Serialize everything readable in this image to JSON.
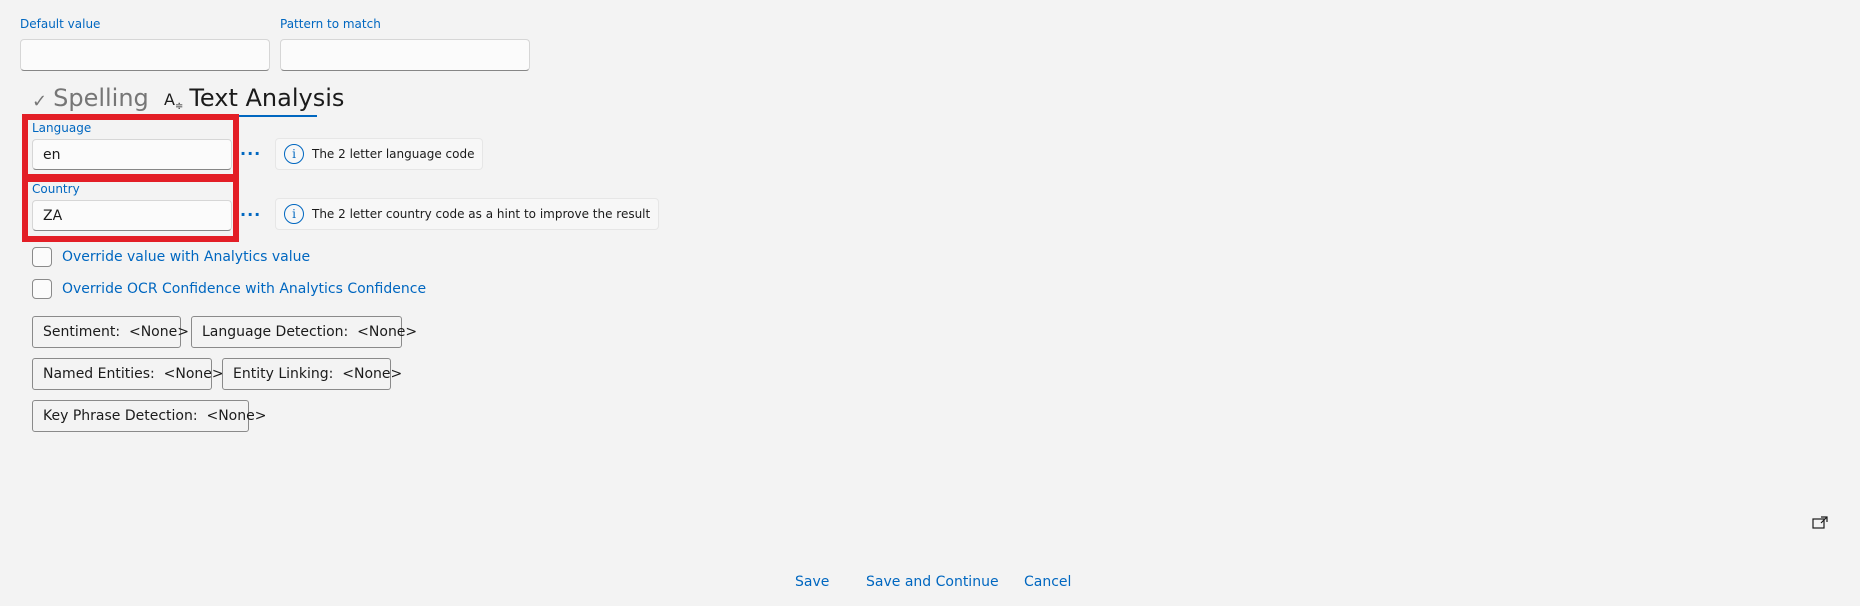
{
  "top_fields": {
    "default_value": {
      "label": "Default value",
      "value": ""
    },
    "pattern": {
      "label": "Pattern to match",
      "value": ""
    }
  },
  "tabs": [
    {
      "label": "Spelling",
      "icon": "checkmark-icon",
      "selected": false
    },
    {
      "label": "Text Analysis",
      "icon": "text-analysis-icon",
      "selected": true
    }
  ],
  "language": {
    "label": "Language",
    "value": "en",
    "ellipsis": "···",
    "info": "The 2 letter language code"
  },
  "country": {
    "label": "Country",
    "value": "ZA",
    "ellipsis": "···",
    "info": "The 2 letter country code as a hint to improve the result"
  },
  "checkboxes": {
    "override_value": "Override value with Analytics value",
    "override_ocr": "Override OCR Confidence with Analytics Confidence"
  },
  "analytics_buttons": {
    "sentiment": "Sentiment:  <None>",
    "language_detection": "Language Detection:  <None>",
    "named_entities": "Named Entities:  <None>",
    "entity_linking": "Entity Linking:  <None>",
    "key_phrase": "Key Phrase Detection:  <None>"
  },
  "footer": {
    "save": "Save",
    "save_continue": "Save and Continue",
    "cancel": "Cancel"
  },
  "colors": {
    "accent": "#0067c0",
    "highlight": "#e31e26",
    "background": "#f3f3f3"
  }
}
